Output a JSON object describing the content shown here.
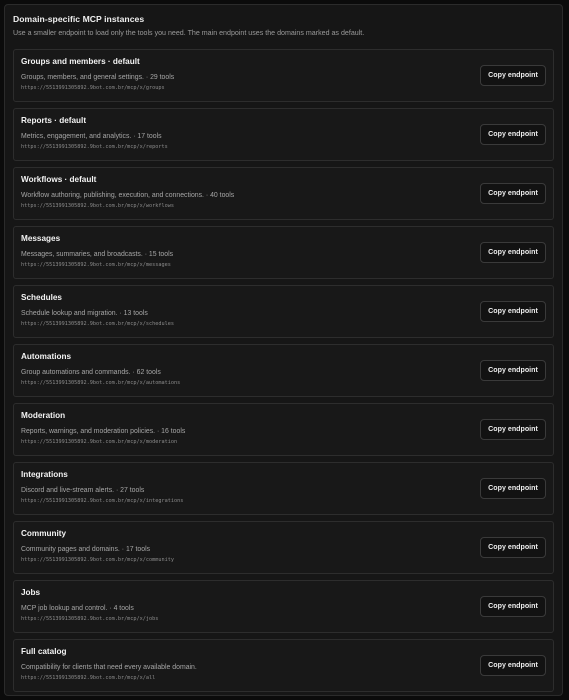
{
  "header": {
    "title": "Domain-specific MCP instances",
    "subtitle": "Use a smaller endpoint to load only the tools you need. The main endpoint uses the domains marked as default."
  },
  "copy_label": "Copy endpoint",
  "instances": [
    {
      "title": "Groups and members · default",
      "description": "Groups, members, and general settings. · 29 tools",
      "url": "https://5513991305892.9bot.com.br/mcp/x/groups"
    },
    {
      "title": "Reports · default",
      "description": "Metrics, engagement, and analytics. · 17 tools",
      "url": "https://5513991305892.9bot.com.br/mcp/x/reports"
    },
    {
      "title": "Workflows · default",
      "description": "Workflow authoring, publishing, execution, and connections. · 40 tools",
      "url": "https://5513991305892.9bot.com.br/mcp/x/workflows"
    },
    {
      "title": "Messages",
      "description": "Messages, summaries, and broadcasts. · 15 tools",
      "url": "https://5513991305892.9bot.com.br/mcp/x/messages"
    },
    {
      "title": "Schedules",
      "description": "Schedule lookup and migration. · 13 tools",
      "url": "https://5513991305892.9bot.com.br/mcp/x/schedules"
    },
    {
      "title": "Automations",
      "description": "Group automations and commands. · 62 tools",
      "url": "https://5513991305892.9bot.com.br/mcp/x/automations"
    },
    {
      "title": "Moderation",
      "description": "Reports, warnings, and moderation policies. · 16 tools",
      "url": "https://5513991305892.9bot.com.br/mcp/x/moderation"
    },
    {
      "title": "Integrations",
      "description": "Discord and live-stream alerts. · 27 tools",
      "url": "https://5513991305892.9bot.com.br/mcp/x/integrations"
    },
    {
      "title": "Community",
      "description": "Community pages and domains. · 17 tools",
      "url": "https://5513991305892.9bot.com.br/mcp/x/community"
    },
    {
      "title": "Jobs",
      "description": "MCP job lookup and control. · 4 tools",
      "url": "https://5513991305892.9bot.com.br/mcp/x/jobs"
    },
    {
      "title": "Full catalog",
      "description": "Compatibility for clients that need every available domain.",
      "url": "https://5513991305892.9bot.com.br/mcp/x/all"
    }
  ]
}
